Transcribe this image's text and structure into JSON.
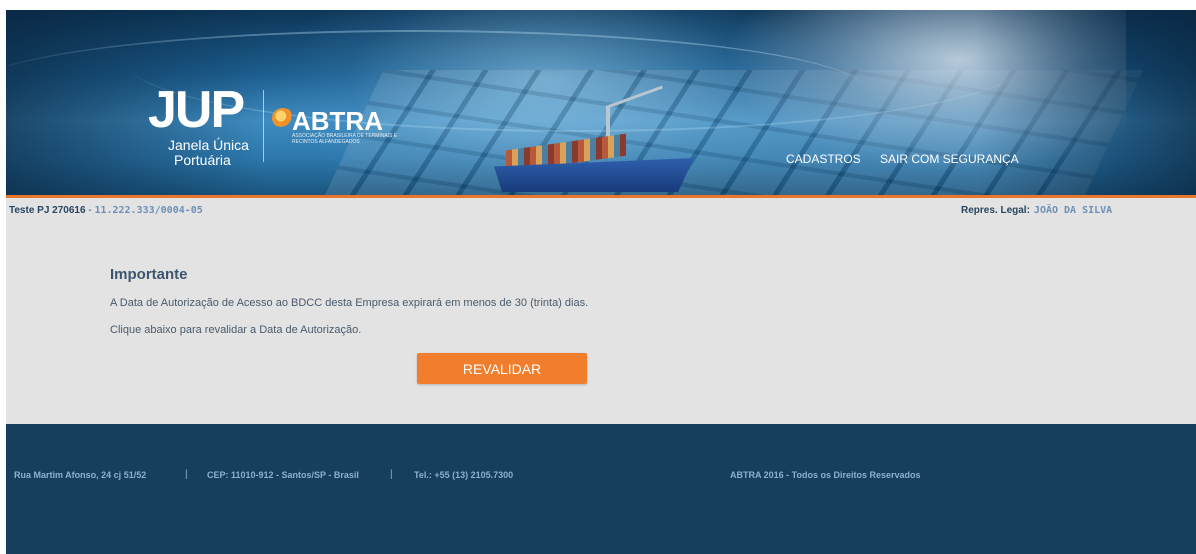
{
  "header": {
    "logo_jup": {
      "mark": "JUP",
      "line1": "Janela Única",
      "line2": "Portuária"
    },
    "logo_abtra": {
      "name": "ABTRA",
      "tagline": "ASSOCIAÇÃO BRASILEIRA DE TERMINAIS E RECINTOS ALFANDEGADOS"
    },
    "nav": {
      "cadastros": "CADASTROS",
      "sair": "SAIR COM SEGURANÇA"
    },
    "accent_color": "#e8762d"
  },
  "company_bar": {
    "company_name": "Teste PJ 270616",
    "separator": " - ",
    "cnpj": "11.222.333/0004-05",
    "legal_label": "Repres. Legal:",
    "legal_value": "JOÃO DA SILVA"
  },
  "notice": {
    "title": "Importante",
    "line1": "A Data de Autorização de Acesso ao BDCC desta Empresa expirará em menos de 30 (trinta) dias.",
    "line2": "Clique abaixo para revalidar a Data de Autorização.",
    "button_label": "REVALIDAR",
    "button_color": "#f07e2c"
  },
  "footer": {
    "address": "Rua Martim Afonso, 24 cj 51/52",
    "cep": "CEP: 11010-912 - Santos/SP - Brasil",
    "phone": "Tel.: +55 (13) 2105.7300",
    "separator": "|",
    "copyright": "ABTRA 2016 - Todos os Direitos Reservados",
    "background_color": "#163f5e"
  }
}
